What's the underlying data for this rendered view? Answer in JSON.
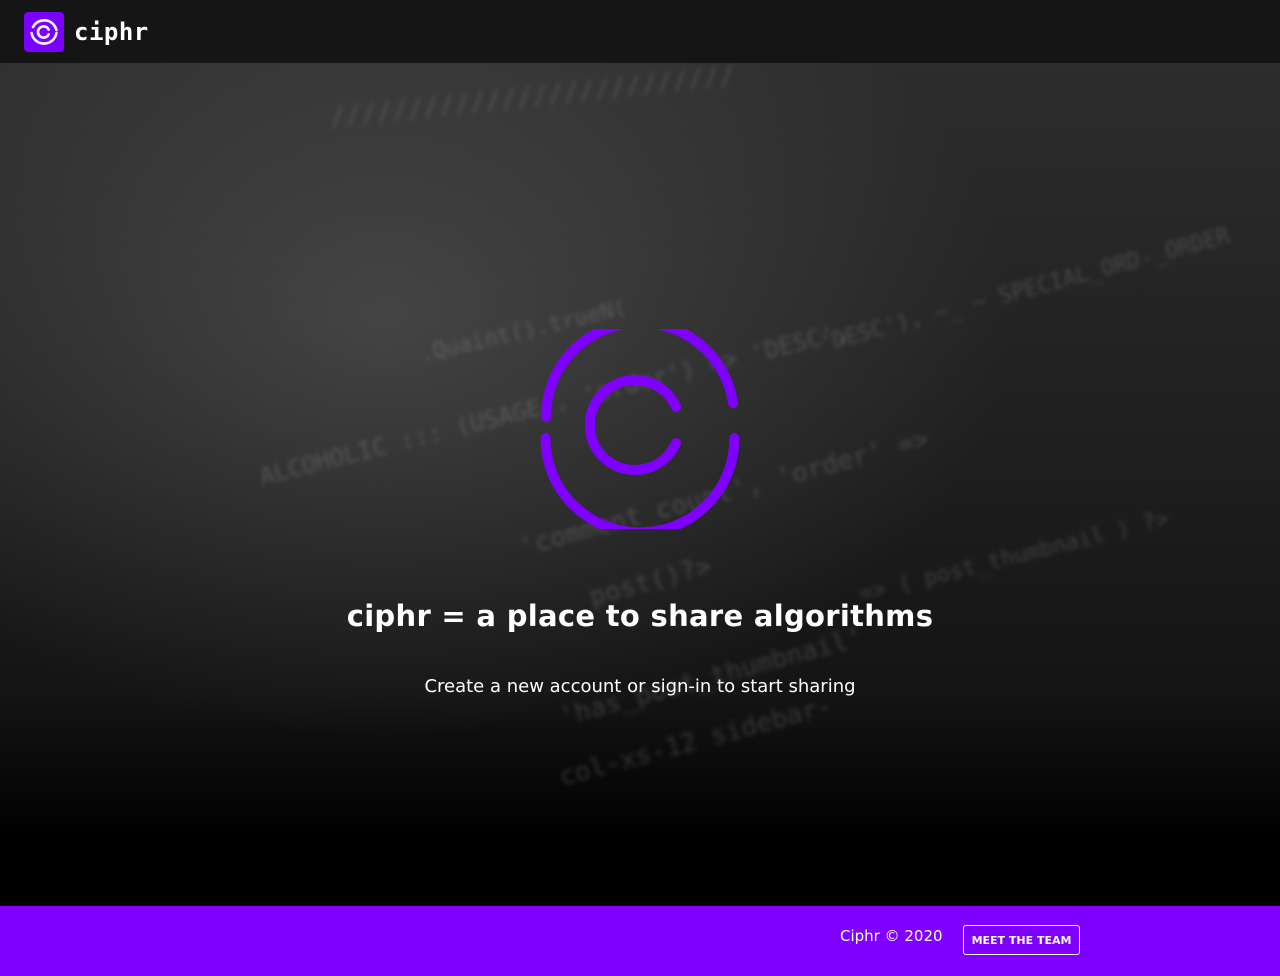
{
  "navbar": {
    "brand_name": "ciphr",
    "logo_icon": "ciphr-logo-icon"
  },
  "hero": {
    "logo_icon": "ciphr-logo-icon",
    "title": "ciphr = a place to share algorithms",
    "subtitle": "Create a new account or sign-in to start sharing"
  },
  "footer": {
    "copyright": "Ciphr © 2020",
    "team_button_label": "MEET THE TEAM"
  },
  "colors": {
    "brand_purple": "#7f00ff",
    "navbar_bg": "#151515",
    "page_bg": "#000000"
  }
}
